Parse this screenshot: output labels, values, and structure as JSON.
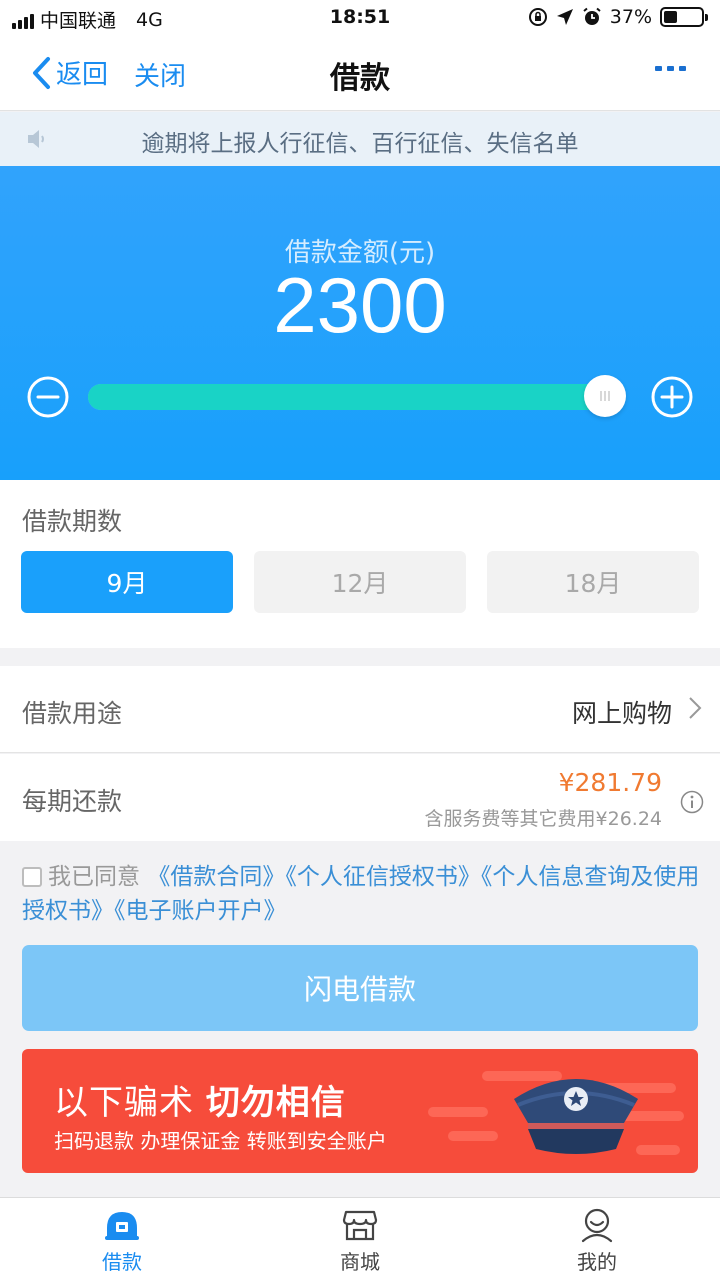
{
  "status_bar": {
    "carrier": "中国联通",
    "network": "4G",
    "time": "18:51",
    "battery": "37%",
    "battery_level": 0.37
  },
  "nav": {
    "back_label": "返回",
    "close_label": "关闭",
    "title": "借款"
  },
  "notice": {
    "text": "逾期将上报人行征信、百行征信、失信名单"
  },
  "loan": {
    "amount_label": "借款金额(元)",
    "amount": "2300",
    "slider_position": 0.98
  },
  "period": {
    "title": "借款期数",
    "options": [
      "9月",
      "12月",
      "18月"
    ],
    "selected": "9月"
  },
  "purpose": {
    "label": "借款用途",
    "value": "网上购物"
  },
  "repayment": {
    "label": "每期还款",
    "amount": "¥281.79",
    "fee_note": "含服务费等其它费用¥26.24"
  },
  "agreement": {
    "prefix": "我已同意",
    "links": [
      "《借款合同》",
      "《个人征信授权书》",
      "《个人信息查询及使用授权书》",
      "《电子账户开户》"
    ],
    "checked": false
  },
  "submit": {
    "label": "闪电借款"
  },
  "warning": {
    "headline_normal": "以下骗术 ",
    "headline_bold": "切勿相信",
    "subtext": "扫码退款 办理保证金 转账到安全账户"
  },
  "tabs": [
    {
      "label": "借款",
      "icon": "loan-icon",
      "active": true
    },
    {
      "label": "商城",
      "icon": "store-icon",
      "active": false
    },
    {
      "label": "我的",
      "icon": "profile-icon",
      "active": false
    }
  ],
  "colors": {
    "primary": "#1a8cf0",
    "panel_blue": "#18a0fb",
    "slider_fill": "#19d3c6",
    "accent_orange": "#f07a31",
    "warning_red": "#f64c3b",
    "submit_disabled": "#7cc6f7"
  }
}
